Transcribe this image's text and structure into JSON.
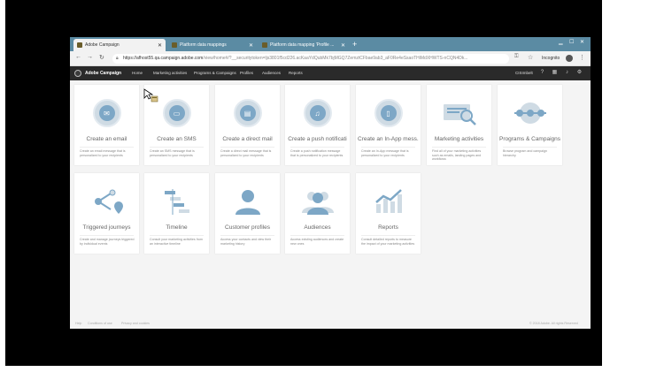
{
  "browser": {
    "tabs": [
      {
        "label": "Adobe Campaign",
        "active": true
      },
      {
        "label": "Platform data mappings",
        "active": false
      },
      {
        "label": "Platform data mapping 'Profile ...",
        "active": false
      }
    ],
    "url_main": "https://afhost55.qa.campaign.adobe.com",
    "url_rest": "/view/home#/?__securitytoken=ljs3801f5cd226.acKaaYdQubMk7bjMGQ7ZemztCFbae9ab3_aF0Re4eSsaoTHiMdXHWTS-nCQN4Dk...",
    "incognito_label": "Incognito"
  },
  "app": {
    "name": "Adobe Campaign",
    "nav": [
      "Home",
      "Marketing activities",
      "Programs & Campaigns",
      "Profiles",
      "Audiences",
      "Reports"
    ],
    "user": "CISImbelt"
  },
  "cards": [
    {
      "title": "Create an email",
      "desc": "Create an email message that is personalized to your recipients",
      "icon": "envelope-icon"
    },
    {
      "title": "Create an SMS",
      "desc": "Create an SMS message that is personalized to your recipients",
      "icon": "sms-icon"
    },
    {
      "title": "Create a direct mail",
      "desc": "Create a direct mail message that is personalized to your recipients",
      "icon": "direct-mail-icon"
    },
    {
      "title": "Create a push notificati",
      "desc": "Create a push notification message that is personalized to your recipients",
      "icon": "bell-icon"
    },
    {
      "title": "Create an In-App mess...",
      "desc": "Create an In-App message that is personalized to your recipients",
      "icon": "mobile-icon"
    },
    {
      "title": "Marketing activities",
      "desc": "Find all of your marketing activities such as emails, landing pages and workflows",
      "icon": "marketing-activities-icon"
    },
    {
      "title": "Programs & Campaigns",
      "desc": "Browse program and campaign hierarchy",
      "icon": "programs-icon"
    },
    {
      "title": "Triggered journeys",
      "desc": "Create and manage journeys triggered by individual events",
      "icon": "journey-icon"
    },
    {
      "title": "Timeline",
      "desc": "Consult your marketing activities from an interactive timeline",
      "icon": "timeline-icon"
    },
    {
      "title": "Customer profiles",
      "desc": "Access your contacts and view their marketing history",
      "icon": "person-icon"
    },
    {
      "title": "Audiences",
      "desc": "Access existing audiences and create new ones",
      "icon": "audiences-icon"
    },
    {
      "title": "Reports",
      "desc": "Consult detailed reports to measure the impact of your marketing activities",
      "icon": "reports-icon"
    }
  ],
  "footer": {
    "links": [
      "Help",
      "Conditions of use",
      "Privacy and cookies"
    ],
    "copyright": "© 2018 Adobe. All rights Reserved"
  },
  "colors": {
    "tabstrip": "#5b8ba3",
    "header": "#2a2a2a",
    "icon_blue": "#7da7c6"
  }
}
